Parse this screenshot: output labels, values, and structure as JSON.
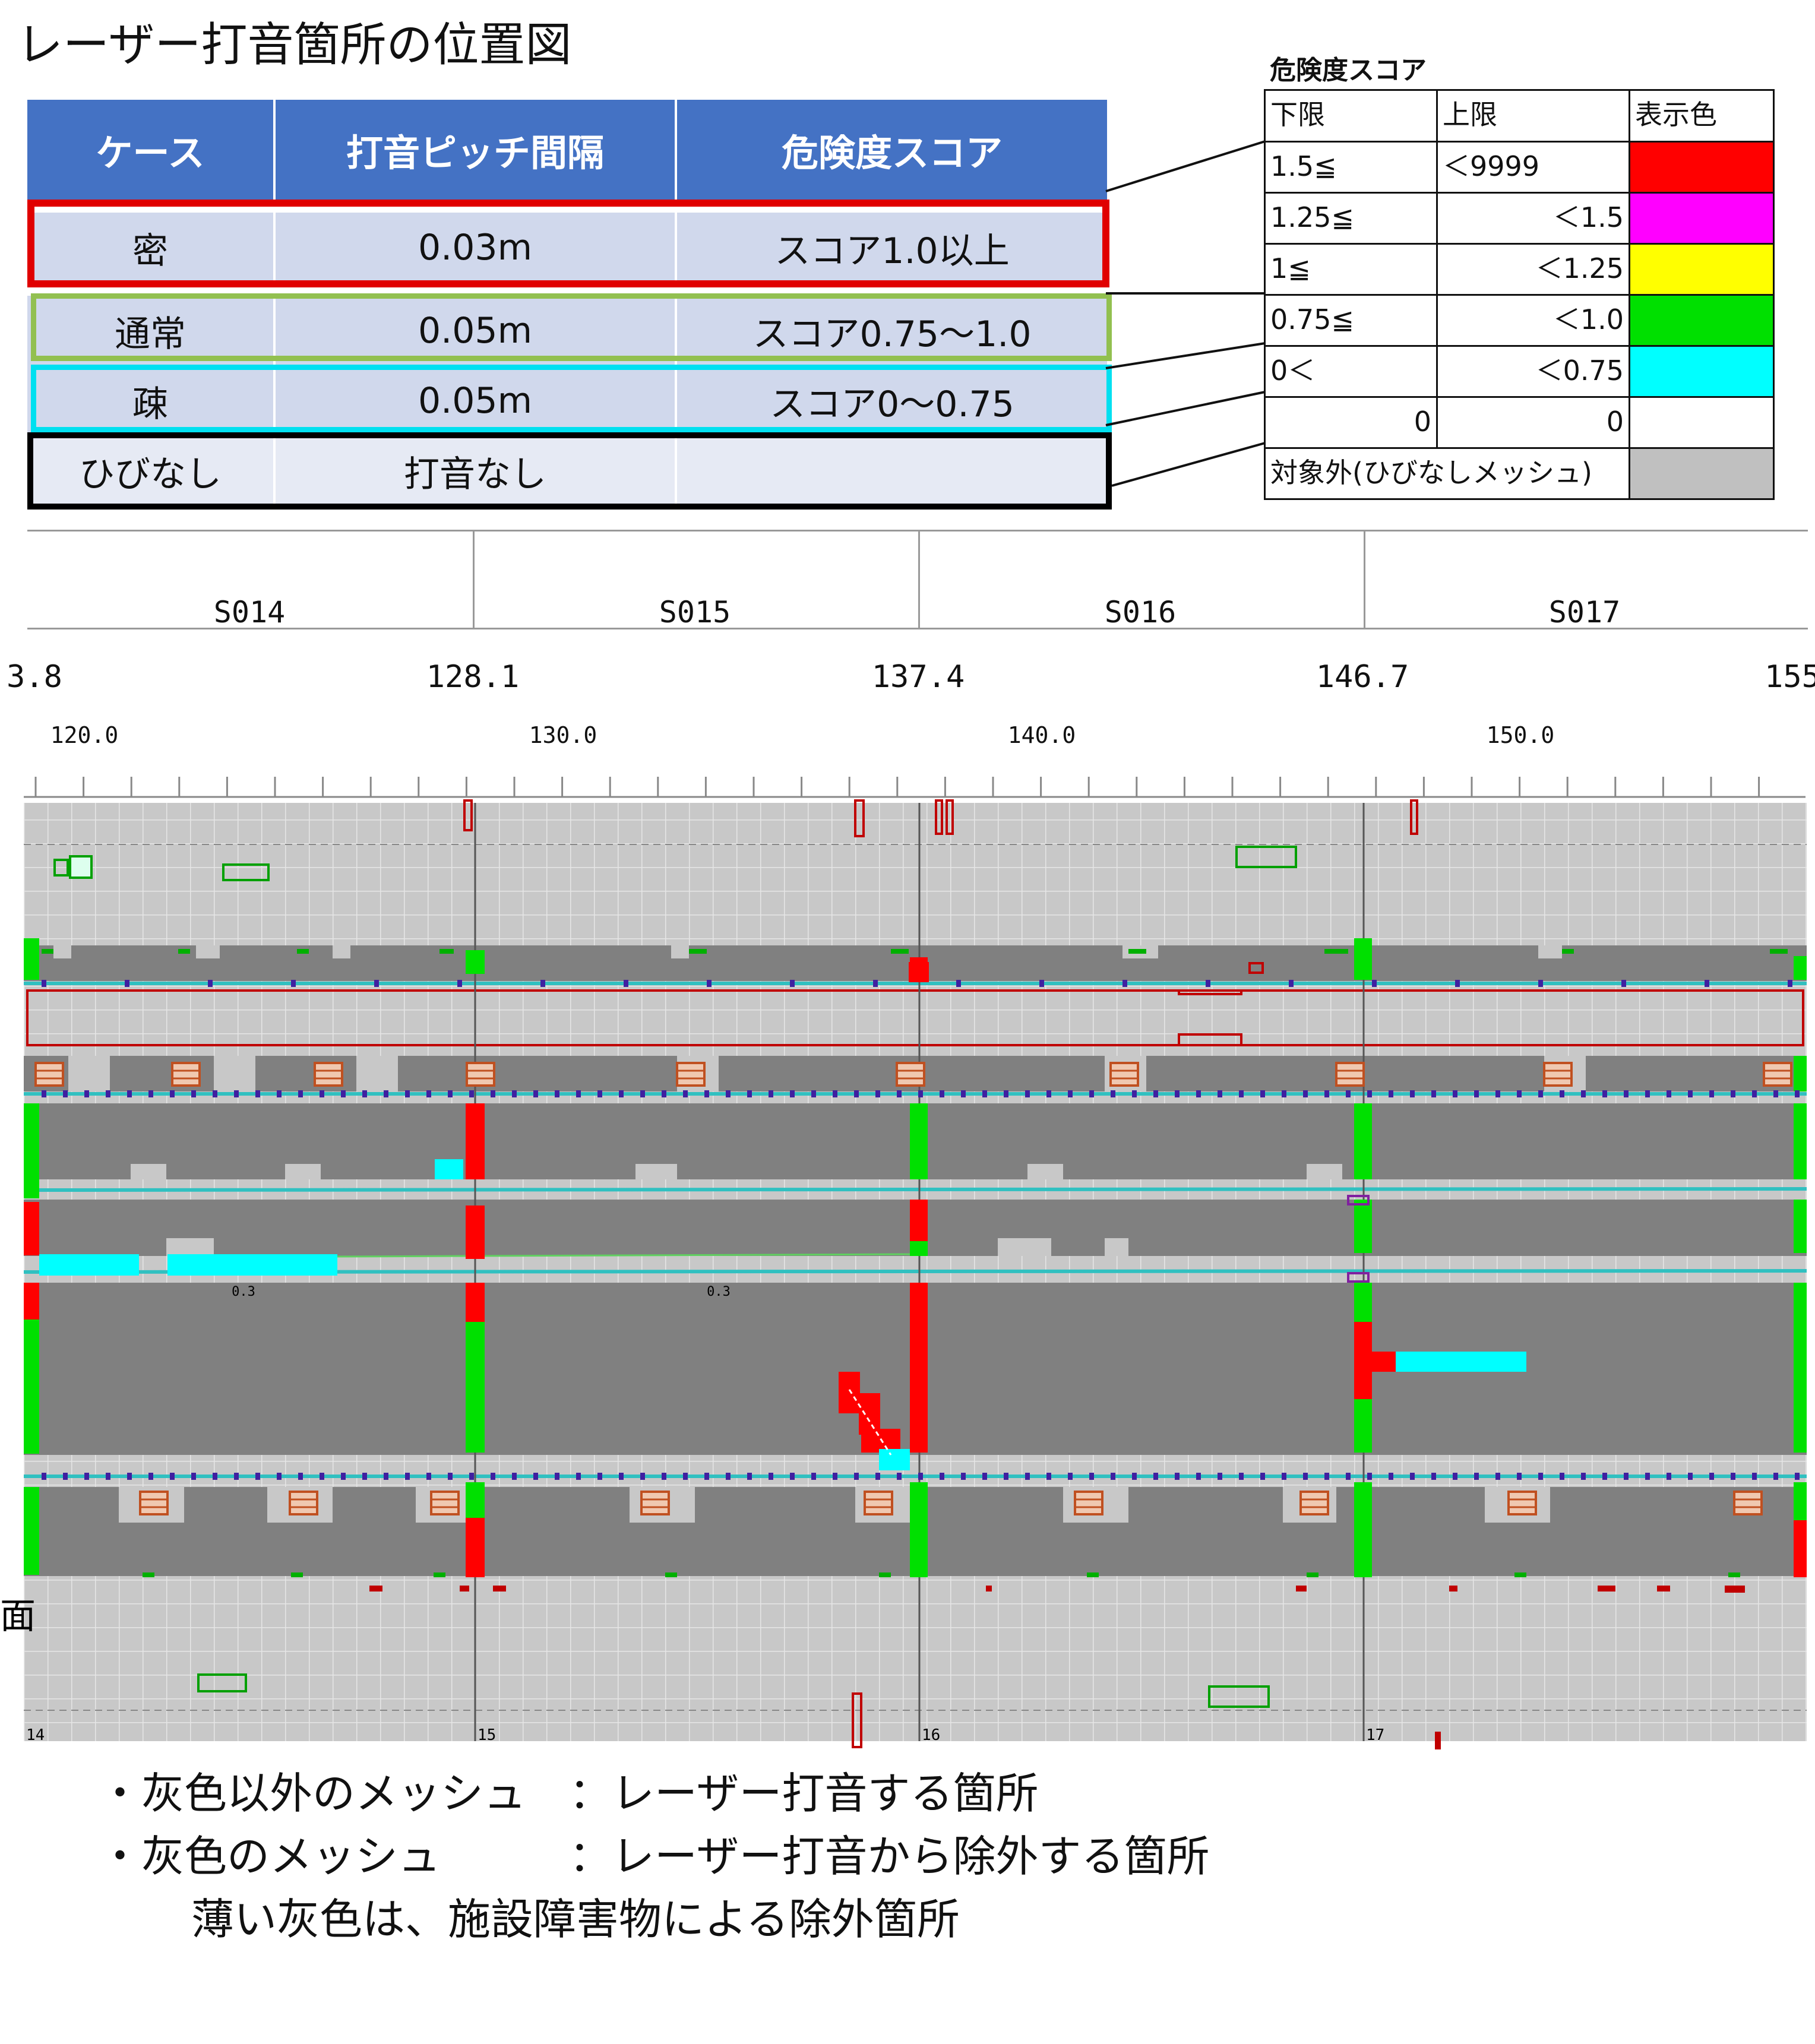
{
  "page_title": "レーザー打音箇所の位置図",
  "case_table": {
    "headers": [
      "ケース",
      "打音ピッチ間隔",
      "危険度スコア"
    ],
    "rows": [
      {
        "case": "密",
        "pitch": "0.03m",
        "score": "スコア1.0以上",
        "frame_color": "#e00000"
      },
      {
        "case": "通常",
        "pitch": "0.05m",
        "score": "スコア0.75～1.0",
        "frame_color": "#92c050"
      },
      {
        "case": "疎",
        "pitch": "0.05m",
        "score": "スコア0～0.75",
        "frame_color": "#00e0f0"
      },
      {
        "case": "ひびなし",
        "pitch": "打音なし",
        "score": "",
        "frame_color": "#000000"
      }
    ]
  },
  "score_table": {
    "title": "危険度スコア",
    "headers": [
      "下限",
      "上限",
      "表示色"
    ],
    "rows": [
      {
        "lower": "1.5≦",
        "upper": "＜9999",
        "color": "#ff0000"
      },
      {
        "lower": "1.25≦",
        "upper": "＜1.5",
        "color": "#ff00ff"
      },
      {
        "lower": "1≦",
        "upper": "＜1.25",
        "color": "#ffff00"
      },
      {
        "lower": "0.75≦",
        "upper": "＜1.0",
        "color": "#00e000"
      },
      {
        "lower": "0＜",
        "upper": "＜0.75",
        "color": "#00ffff"
      },
      {
        "lower": "0",
        "upper": "0",
        "color": "#ffffff"
      },
      {
        "lower": "対象外(ひびなしメッシュ)",
        "upper": "",
        "color": "#c0c0c0"
      }
    ]
  },
  "sections": [
    "S014",
    "S015",
    "S016",
    "S017"
  ],
  "km_marks": [
    "3.8",
    "128.1",
    "137.4",
    "146.7",
    "155"
  ],
  "scale_marks": [
    "120.0",
    "130.0",
    "140.0",
    "150.0"
  ],
  "mesh_labels": {
    "dim_a": "0.3",
    "dim_b": "0.3",
    "bottom": [
      "14",
      "15",
      "16",
      "17"
    ],
    "left_edge": "面"
  },
  "colors": {
    "header_blue": "#4472c4",
    "row_fill": "#d0d8ec",
    "mesh_dark": "#808080",
    "mesh_light": "#c8c8c8",
    "red": "#ff0000",
    "green": "#00e000",
    "cyan": "#00ffff"
  },
  "notes": [
    "・灰色以外のメッシュ　：レーザー打音する箇所",
    "・灰色のメッシュ　　　：レーザー打音から除外する箇所",
    "薄い灰色は、施設障害物による除外箇所"
  ]
}
